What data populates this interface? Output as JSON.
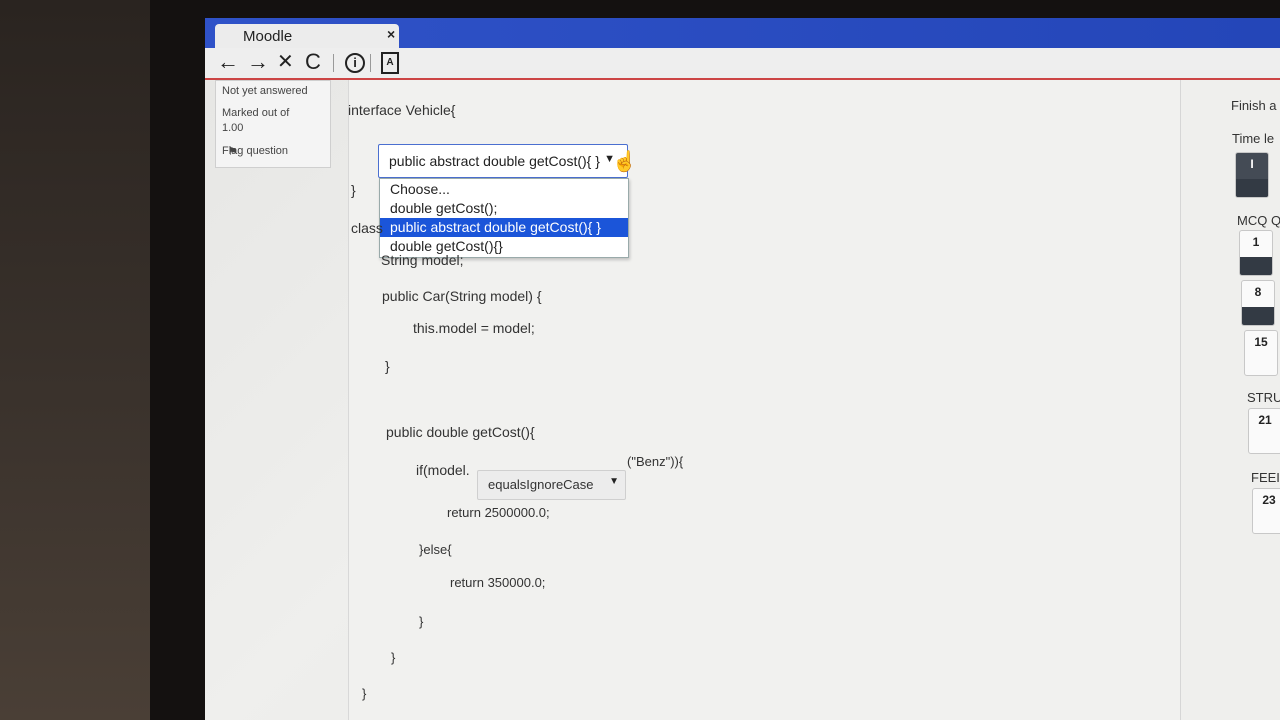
{
  "browser": {
    "tab_title": "Moodle",
    "tab_close": "×",
    "nav": {
      "back": "←",
      "forward": "→",
      "stop": "✕",
      "reload": "C"
    }
  },
  "question_info": {
    "status": "Not yet answered",
    "marked_label": "Marked out of",
    "marked_value": "1.00",
    "flag_label": "Flag question"
  },
  "code": {
    "line_interface": "interface Vehicle{",
    "brace_close_1": "}",
    "class_prefix": "class",
    "line_field": "String model;",
    "line_ctor": "public Car(String model) {",
    "line_assign": "this.model = model;",
    "brace_close_2": "}",
    "line_method": "public double getCost(){",
    "line_if_prefix": "if(model.",
    "line_if_suffix": "(\"Benz\")){",
    "line_return1": "return 2500000.0;",
    "line_else": "}else{",
    "line_return2": "return 350000.0;",
    "brace_close_3": "}",
    "brace_close_4": "}",
    "brace_close_5": "}"
  },
  "dropdown1": {
    "selected": "public abstract double getCost(){ }",
    "options": [
      "Choose...",
      "double getCost();",
      "public abstract double getCost(){ }",
      "double getCost(){}"
    ],
    "highlighted_index": 2
  },
  "dropdown2": {
    "selected": "equalsIgnoreCase"
  },
  "nav_panel": {
    "finish_label": "Finish a",
    "time_label": "Time le",
    "timer_value": "I",
    "section_mcq": "MCQ Q",
    "section_stru": "STRU",
    "section_feed": "FEEI",
    "buttons": [
      "1",
      "8",
      "15",
      "21",
      "23"
    ]
  }
}
